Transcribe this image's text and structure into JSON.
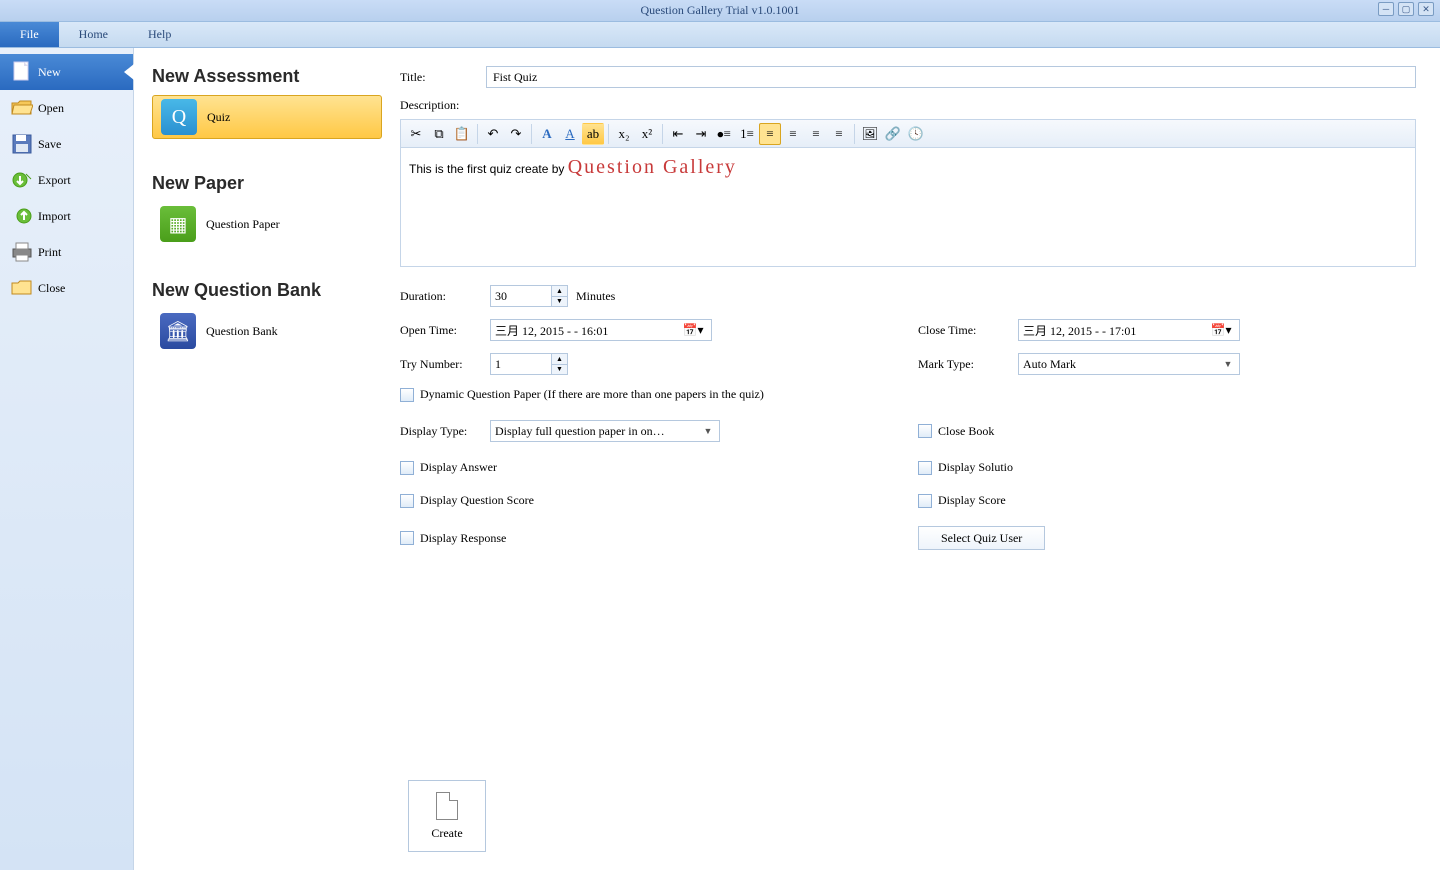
{
  "window": {
    "title": "Question Gallery Trial   v1.0.1001"
  },
  "menu": {
    "file": "File",
    "home": "Home",
    "help": "Help"
  },
  "sidebar": {
    "items": [
      {
        "label": "New"
      },
      {
        "label": "Open"
      },
      {
        "label": "Save"
      },
      {
        "label": "Export"
      },
      {
        "label": "Import"
      },
      {
        "label": "Print"
      },
      {
        "label": "Close"
      }
    ]
  },
  "midpanel": {
    "new_assessment": "New Assessment",
    "quiz": "Quiz",
    "new_paper": "New Paper",
    "question_paper": "Question Paper",
    "new_question_bank": "New Question Bank",
    "question_bank": "Question Bank"
  },
  "form": {
    "title_label": "Title:",
    "title_value": "Fist Quiz",
    "description_label": "Description:",
    "desc_plain": "This is the first quiz create by ",
    "desc_red": "Question Gallery",
    "duration_label": "Duration:",
    "duration_value": "30",
    "duration_unit": "Minutes",
    "open_time_label": "Open Time:",
    "open_time_value": "三月  12, 2015 - - 16:01",
    "close_time_label": "Close Time:",
    "close_time_value": "三月  12, 2015 - - 17:01",
    "try_number_label": "Try Number:",
    "try_number_value": "1",
    "mark_type_label": "Mark Type:",
    "mark_type_value": "Auto Mark",
    "dynamic_label": "Dynamic Question Paper (If there are more than one papers in the quiz)",
    "display_type_label": "Display Type:",
    "display_type_value": "Display full question paper in on…",
    "close_book": "Close Book",
    "display_answer": "Display Answer",
    "display_solutio": "Display Solutio",
    "display_question_score": "Display Question Score",
    "display_score": "Display Score",
    "display_response": "Display Response",
    "select_user": "Select Quiz User",
    "create": "Create"
  }
}
